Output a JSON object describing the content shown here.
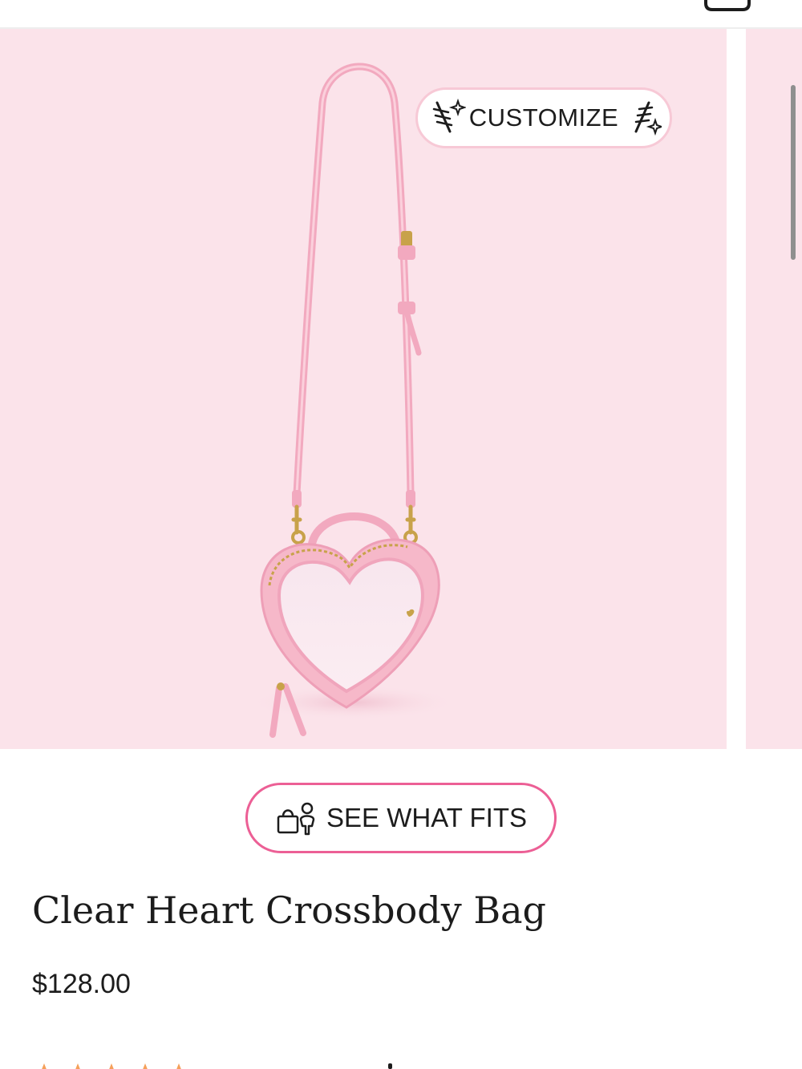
{
  "header": {
    "search_icon": "search-icon",
    "bag_icon": "shopping-bag-icon"
  },
  "gallery": {
    "background_color": "#fbe3ea",
    "product_color": "#f6b8c9",
    "hardware_color": "#c8a24a"
  },
  "customize": {
    "label": "CUSTOMIZE",
    "left_icon": "sparkle-pin-icon",
    "right_icon": "sparkle-pin-icon",
    "border_color": "#f7c9d6"
  },
  "fit_guide": {
    "label": "SEE WHAT FITS",
    "icon": "bag-and-person-icon",
    "border_color": "#ec5f95"
  },
  "product": {
    "title": "Clear Heart Crossbody Bag",
    "price": "$128.00"
  },
  "reviews": {
    "star_color": "#f5a05a",
    "star_count": 5
  }
}
